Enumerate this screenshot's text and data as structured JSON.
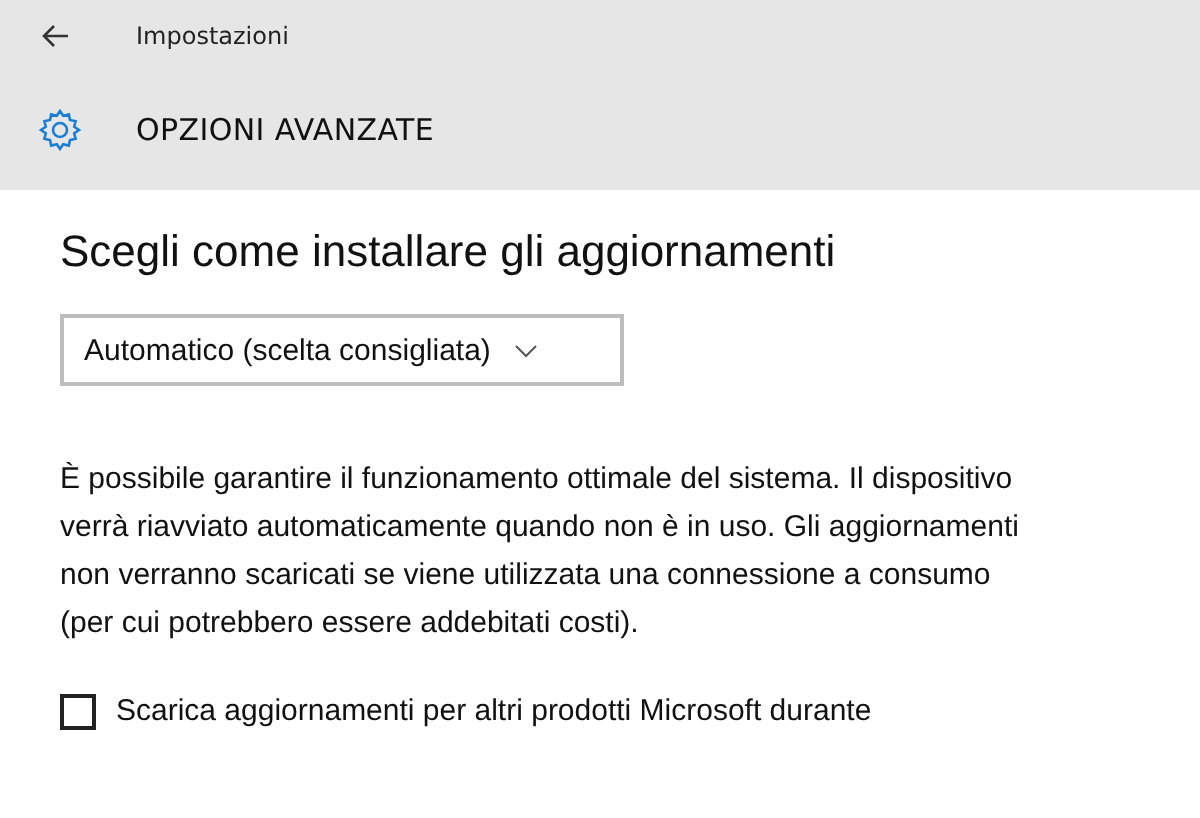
{
  "window": {
    "title": "Impostazioni"
  },
  "page": {
    "title": "OPZIONI AVANZATE"
  },
  "section": {
    "heading": "Scegli come installare gli aggiornamenti"
  },
  "dropdown": {
    "value": "Automatico (scelta consigliata)"
  },
  "description": "È possibile garantire il funzionamento ottimale del sistema. Il dispositivo verrà riavviato automaticamente quando non è in uso. Gli aggiornamenti non verranno scaricati se viene utilizzata una connessione a consumo (per cui potrebbero essere addebitati costi).",
  "options": [
    {
      "label": "Scarica aggiornamenti per altri prodotti Microsoft durante",
      "checked": false
    }
  ]
}
